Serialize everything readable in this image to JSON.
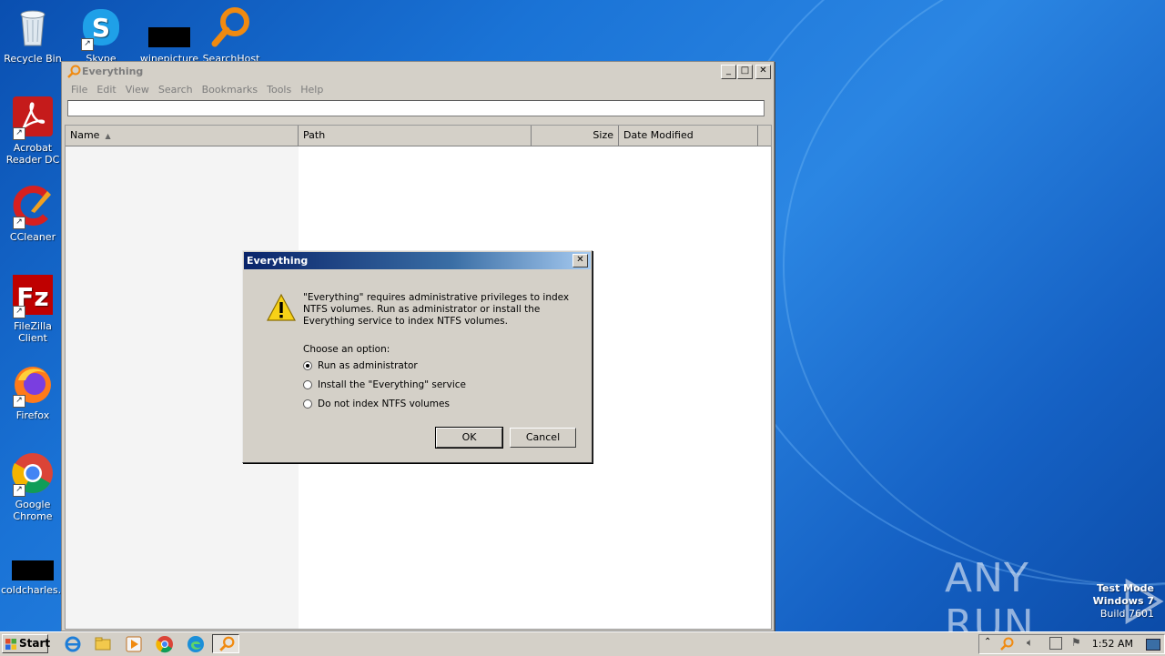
{
  "desktop": {
    "icons": [
      {
        "label": "Recycle Bin"
      },
      {
        "label": "Skype"
      },
      {
        "label": "winepicture"
      },
      {
        "label": "SearchHost"
      },
      {
        "label": "Acrobat Reader DC"
      },
      {
        "label": "CCleaner"
      },
      {
        "label": "FileZilla Client"
      },
      {
        "label": "Firefox"
      },
      {
        "label": "Google Chrome"
      },
      {
        "label": "coldcharles..."
      }
    ]
  },
  "main_window": {
    "title": "Everything",
    "menu": [
      "File",
      "Edit",
      "View",
      "Search",
      "Bookmarks",
      "Tools",
      "Help"
    ],
    "search": {
      "value": "",
      "placeholder": ""
    },
    "columns": [
      "Name",
      "Path",
      "Size",
      "Date Modified"
    ]
  },
  "dialog": {
    "title": "Everything",
    "message": "\"Everything\" requires administrative privileges to index NTFS volumes. Run as administrator or install the Everything service to index NTFS volumes.",
    "choose_label": "Choose an option:",
    "options": [
      {
        "label": "Run as administrator",
        "selected": true
      },
      {
        "label": "Install the \"Everything\" service",
        "selected": false
      },
      {
        "label": "Do not index NTFS volumes",
        "selected": false
      }
    ],
    "ok_label": "OK",
    "cancel_label": "Cancel"
  },
  "taskbar": {
    "start_label": "Start",
    "clock": "1:52 AM"
  },
  "watermark": {
    "line1": "Test Mode",
    "line2": "Windows 7",
    "line3": "Build 7601",
    "brand": "ANY RUN"
  },
  "colors": {
    "desktop_blue": "#1a73d6",
    "dialog_title_start": "#0a246a",
    "dialog_title_end": "#a6caf0",
    "window_face": "#d4d0c8"
  }
}
